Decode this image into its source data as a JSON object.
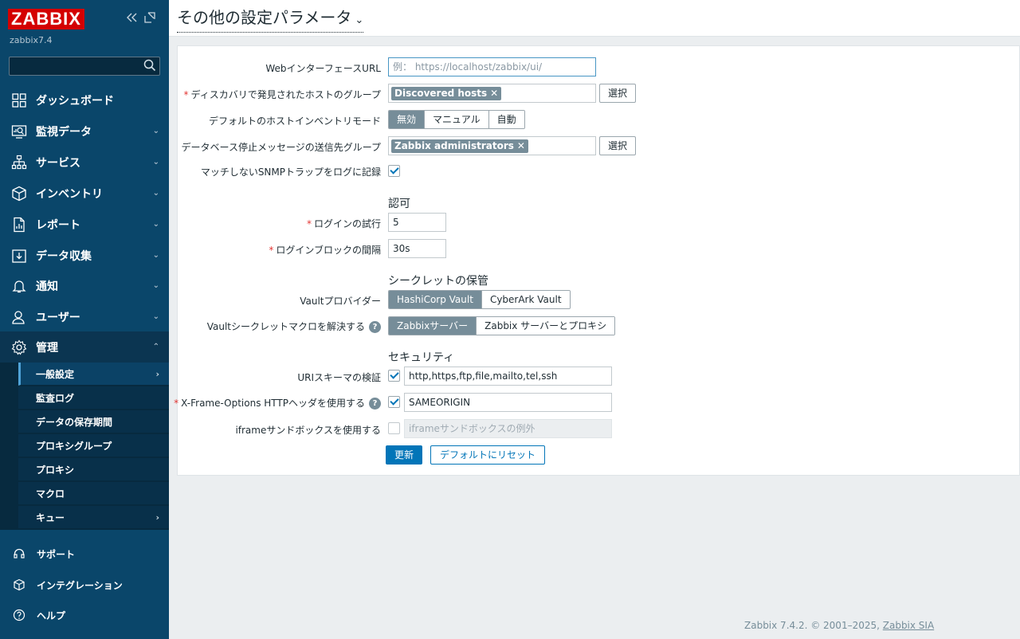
{
  "sidebar": {
    "logo": "ZABBIX",
    "version": "zabbix7.4",
    "collapse_icon": "double-chevron-left-icon",
    "kiosk_icon": "kiosk-icon",
    "search_value": "",
    "menu": [
      {
        "label": "ダッシュボード",
        "icon": "dashboard-icon"
      },
      {
        "label": "監視データ",
        "icon": "monitoring-icon"
      },
      {
        "label": "サービス",
        "icon": "services-icon"
      },
      {
        "label": "インベントリ",
        "icon": "inventory-icon"
      },
      {
        "label": "レポート",
        "icon": "reports-icon"
      },
      {
        "label": "データ収集",
        "icon": "data-collection-icon"
      },
      {
        "label": "通知",
        "icon": "bell-icon"
      },
      {
        "label": "ユーザー",
        "icon": "users-icon"
      },
      {
        "label": "管理",
        "icon": "gear-icon"
      }
    ],
    "submenu": [
      {
        "label": "一般設定"
      },
      {
        "label": "監査ログ"
      },
      {
        "label": "データの保存期間"
      },
      {
        "label": "プロキシグループ"
      },
      {
        "label": "プロキシ"
      },
      {
        "label": "マクロ"
      },
      {
        "label": "キュー"
      }
    ],
    "bottom": [
      {
        "label": "サポート",
        "icon": "headset-icon"
      },
      {
        "label": "インテグレーション",
        "icon": "integrations-icon"
      },
      {
        "label": "ヘルプ",
        "icon": "help-icon"
      }
    ]
  },
  "header": {
    "title": "その他の設定パラメータ"
  },
  "form": {
    "web_url_label": "WebインターフェースURL",
    "web_url_placeholder": "例： https://localhost/zabbix/ui/",
    "discovery_group_label": "ディスカバリで発見されたホストのグループ",
    "discovery_group_chip": "Discovered hosts",
    "select_label": "選択",
    "inventory_mode_label": "デフォルトのホストインベントリモード",
    "inventory_modes": [
      "無効",
      "マニュアル",
      "自動"
    ],
    "db_alert_label": "データベース停止メッセージの送信先グループ",
    "db_alert_chip": "Zabbix administrators",
    "snmp_log_label": "マッチしないSNMPトラップをログに記録",
    "auth_section": "認可",
    "login_attempts_label": "ログインの試行",
    "login_attempts_value": "5",
    "login_block_label": "ログインブロックの間隔",
    "login_block_value": "30s",
    "secret_section": "シークレットの保管",
    "vault_provider_label": "Vaultプロバイダー",
    "vault_providers": [
      "HashiCorp Vault",
      "CyberArk Vault"
    ],
    "vault_macro_label": "Vaultシークレットマクロを解決する",
    "vault_macro_options": [
      "Zabbixサーバー",
      "Zabbix サーバーとプロキシ"
    ],
    "security_section": "セキュリティ",
    "uri_check_label": "URIスキーマの検証",
    "uri_check_value": "http,https,ftp,file,mailto,tel,ssh",
    "xframe_label": "X-Frame-Options HTTPヘッダを使用する",
    "xframe_value": "SAMEORIGIN",
    "iframe_label": "iframeサンドボックスを使用する",
    "iframe_placeholder": "iframeサンドボックスの例外",
    "help_glyph": "?",
    "update_button": "更新",
    "reset_button": "デフォルトにリセット"
  },
  "footer": {
    "text": "Zabbix 7.4.2. © 2001–2025, ",
    "link": "Zabbix SIA"
  }
}
